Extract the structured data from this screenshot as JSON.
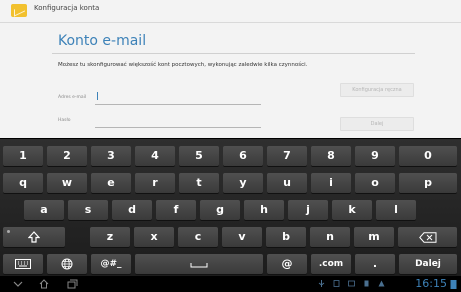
{
  "window": {
    "title": "Konfiguracja konta"
  },
  "page": {
    "heading": "Konto e-mail",
    "intro": "Możesz tu skonfigurować większość kont pocztowych, wykonując zaledwie kilka czynności."
  },
  "form": {
    "email_label": "Adres e-mail",
    "email_value": "",
    "password_label": "Hasło",
    "password_value": "",
    "manual_setup_label": "Konfiguracja ręczna",
    "next_label": "Dalej"
  },
  "keyboard": {
    "row1": [
      "1",
      "2",
      "3",
      "4",
      "5",
      "6",
      "7",
      "8",
      "9",
      "0"
    ],
    "row2": [
      "q",
      "w",
      "e",
      "r",
      "t",
      "y",
      "u",
      "i",
      "o",
      "p"
    ],
    "row3": [
      "a",
      "s",
      "d",
      "f",
      "g",
      "h",
      "j",
      "k",
      "l"
    ],
    "row4": [
      "z",
      "x",
      "c",
      "v",
      "b",
      "n",
      "m"
    ],
    "symbols_label": "@#_",
    "at_label": "@",
    "dotcom_label": ".com",
    "period_label": ".",
    "enter_label": "Dalej"
  },
  "icons": {
    "shift": "shift-icon",
    "backspace": "backspace-icon",
    "keyboard_settings": "keyboard-icon",
    "language": "globe-icon",
    "space": "space-icon"
  },
  "system_bar": {
    "time": "16:15"
  },
  "colors": {
    "accent": "#3d82b8",
    "app_icon": "#f2c12e",
    "keyboard_bg": "#262626"
  }
}
